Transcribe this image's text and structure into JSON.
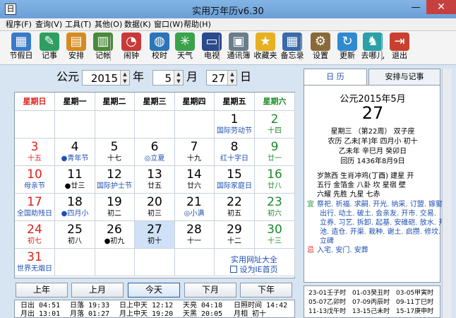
{
  "window": {
    "title": "实用万年历v6.30",
    "minimize": "—",
    "close": "✕",
    "app_icon": "日"
  },
  "menu": [
    "程序(F)",
    "查询(V)",
    "工具(T)",
    "其他(O)",
    "数据(K)",
    "窗口(W)",
    "帮助(H)"
  ],
  "toolbar": [
    {
      "label": "节假日",
      "icon": "calendar-icon",
      "color": "#3a7bc8",
      "glyph": "▦"
    },
    {
      "label": "记事",
      "icon": "notebook-icon",
      "color": "#2f9e60",
      "glyph": "✎"
    },
    {
      "label": "安排",
      "icon": "schedule-icon",
      "color": "#d58b20",
      "glyph": "▤"
    },
    {
      "label": "记帐",
      "icon": "ledger-icon",
      "color": "#4a8a3a",
      "glyph": "▥"
    },
    {
      "label": "闹钟",
      "icon": "alarm-clock-icon",
      "color": "#c83a3a",
      "glyph": "◔"
    },
    {
      "label": "校时",
      "icon": "globe-clock-icon",
      "color": "#2b75b8",
      "glyph": "◍"
    },
    {
      "label": "天气",
      "icon": "weather-icon",
      "color": "#3aa24a",
      "glyph": "✳"
    },
    {
      "label": "电视",
      "icon": "tv-icon",
      "color": "#2b4a8c",
      "glyph": "▭"
    },
    {
      "label": "通讯簿",
      "icon": "address-book-icon",
      "color": "#6a7d8c",
      "glyph": "▣"
    },
    {
      "label": "收藏夹",
      "icon": "star-icon",
      "color": "#e6b020",
      "glyph": "★"
    },
    {
      "label": "备忘录",
      "icon": "memo-icon",
      "color": "#3a6aa8",
      "glyph": "▦"
    },
    {
      "label": "设置",
      "icon": "settings-icon",
      "color": "#8a6a3a",
      "glyph": "⚙"
    },
    {
      "label": "更新",
      "icon": "update-icon",
      "color": "#2f8ad0",
      "glyph": "↻"
    },
    {
      "label": "去哪儿",
      "icon": "camel-icon",
      "color": "#2aa0a8",
      "glyph": "♞"
    },
    {
      "label": "退出",
      "icon": "exit-icon",
      "color": "#c84030",
      "glyph": "⇥"
    }
  ],
  "datebar": {
    "era": "公元",
    "year": "2015",
    "year_unit": "年",
    "month": "5",
    "month_unit": "月",
    "day": "27",
    "day_unit": "日"
  },
  "weekdays": [
    {
      "label": "星期日",
      "color": "#e0201a"
    },
    {
      "label": "星期一",
      "color": "#000000"
    },
    {
      "label": "星期二",
      "color": "#000000"
    },
    {
      "label": "星期三",
      "color": "#000000"
    },
    {
      "label": "星期四",
      "color": "#000000"
    },
    {
      "label": "星期五",
      "color": "#000000"
    },
    {
      "label": "星期六",
      "color": "#1a8c28"
    }
  ],
  "calendar": [
    [
      {
        "day": "",
        "lunar": ""
      },
      {
        "day": "",
        "lunar": ""
      },
      {
        "day": "",
        "lunar": ""
      },
      {
        "day": "",
        "lunar": ""
      },
      {
        "day": "",
        "lunar": ""
      },
      {
        "day": "1",
        "lunar": "国际劳动节",
        "dc": "",
        "lc": "blue"
      },
      {
        "day": "2",
        "lunar": "十四",
        "dc": "green",
        "lc": "green"
      }
    ],
    [
      {
        "day": "3",
        "lunar": "十五",
        "dc": "red",
        "lc": "red"
      },
      {
        "day": "4",
        "lunar": "●青年节",
        "dc": "",
        "lc": "blue"
      },
      {
        "day": "5",
        "lunar": "十七",
        "dc": "",
        "lc": ""
      },
      {
        "day": "6",
        "lunar": "◎立夏",
        "dc": "",
        "lc": "blue"
      },
      {
        "day": "7",
        "lunar": "十九",
        "dc": "",
        "lc": ""
      },
      {
        "day": "8",
        "lunar": "红十字日",
        "dc": "",
        "lc": "blue"
      },
      {
        "day": "9",
        "lunar": "廿一",
        "dc": "green",
        "lc": "green"
      }
    ],
    [
      {
        "day": "10",
        "lunar": "母亲节",
        "dc": "red",
        "lc": "blue"
      },
      {
        "day": "11",
        "lunar": "●廿三",
        "dc": "",
        "lc": ""
      },
      {
        "day": "12",
        "lunar": "国际护士节",
        "dc": "",
        "lc": "blue"
      },
      {
        "day": "13",
        "lunar": "廿五",
        "dc": "",
        "lc": ""
      },
      {
        "day": "14",
        "lunar": "廿六",
        "dc": "",
        "lc": ""
      },
      {
        "day": "15",
        "lunar": "国际家庭日",
        "dc": "",
        "lc": "blue"
      },
      {
        "day": "16",
        "lunar": "廿八",
        "dc": "green",
        "lc": "green"
      }
    ],
    [
      {
        "day": "17",
        "lunar": "全国助残日",
        "dc": "red",
        "lc": "blue"
      },
      {
        "day": "18",
        "lunar": "●四月小",
        "dc": "",
        "lc": "blue"
      },
      {
        "day": "19",
        "lunar": "初二",
        "dc": "",
        "lc": ""
      },
      {
        "day": "20",
        "lunar": "初三",
        "dc": "",
        "lc": ""
      },
      {
        "day": "21",
        "lunar": "◎小满",
        "dc": "",
        "lc": "blue"
      },
      {
        "day": "22",
        "lunar": "初五",
        "dc": "",
        "lc": ""
      },
      {
        "day": "23",
        "lunar": "初六",
        "dc": "green",
        "lc": "green"
      }
    ],
    [
      {
        "day": "24",
        "lunar": "初七",
        "dc": "red",
        "lc": "red"
      },
      {
        "day": "25",
        "lunar": "初八",
        "dc": "",
        "lc": ""
      },
      {
        "day": "26",
        "lunar": "●初九",
        "dc": "",
        "lc": ""
      },
      {
        "day": "27",
        "lunar": "初十",
        "dc": "",
        "lc": "",
        "today": true
      },
      {
        "day": "28",
        "lunar": "十一",
        "dc": "",
        "lc": ""
      },
      {
        "day": "29",
        "lunar": "十二",
        "dc": "",
        "lc": ""
      },
      {
        "day": "30",
        "lunar": "十三",
        "dc": "green",
        "lc": "green"
      }
    ],
    [
      {
        "day": "31",
        "lunar": "世界无烟日",
        "dc": "red",
        "lc": "blue"
      },
      {
        "day": "",
        "lunar": ""
      },
      {
        "day": "",
        "lunar": ""
      },
      {
        "day": "",
        "lunar": ""
      },
      {
        "day": "",
        "lunar": ""
      },
      {
        "day": "",
        "lunar": ""
      },
      {
        "day": "",
        "lunar": ""
      }
    ]
  ],
  "links": {
    "site": "实用网址大全",
    "homepage": "设为IE首页"
  },
  "nav": [
    "上年",
    "上月",
    "今天",
    "下月",
    "下年"
  ],
  "suninfo": [
    "日出 04:51",
    "日落 19:33",
    "日上中天 12:12",
    "天亮 04:18",
    "日照时间 14:42",
    "月出 13:01",
    "月落 01:27",
    "月上中天 19:20",
    "天黑 20:05",
    "月相 初十"
  ],
  "tabs": {
    "day": "日    历",
    "schedule": "安排与记事"
  },
  "detail": {
    "date": "公元2015年5月",
    "day": "27",
    "week": "星期三 （第22周） 双子座",
    "lunar": "农历 乙未[羊]年 四月小 初十",
    "ganzhi": "乙未年 辛巳月 癸卯日",
    "hijri": "回历 1436年8月9日",
    "l1": "岁煞西 生肖冲鸡(丁酉) 建星 开",
    "l2": "五行 金箔金 八卦 坎 星宿 壁",
    "l3": "六耀 先胜 九星 七赤",
    "yi_tag": "宜",
    "yi": [
      "祭祀. 祈福. 求嗣. 开光. 纳采. 订盟. 嫁娶",
      "出行. 动土. 破土. 会亲友. 开市. 交易.",
      "立券. 习艺. 拆卸. 起基. 安碓硙. 放水. 开",
      "池. 造仓. 开渠. 栽种. 谢土. 启攒. 修坟.",
      "立碑"
    ],
    "ji_tag": "忌",
    "ji": "入宅. 安门. 安葬"
  },
  "hours": [
    "23-01壬子时",
    "01-03癸丑时",
    "03-05甲寅时",
    "05-07乙卯时",
    "07-09丙辰时",
    "09-11丁巳时",
    "11-13戊午时",
    "13-15己未时",
    "15-17庚申时"
  ]
}
